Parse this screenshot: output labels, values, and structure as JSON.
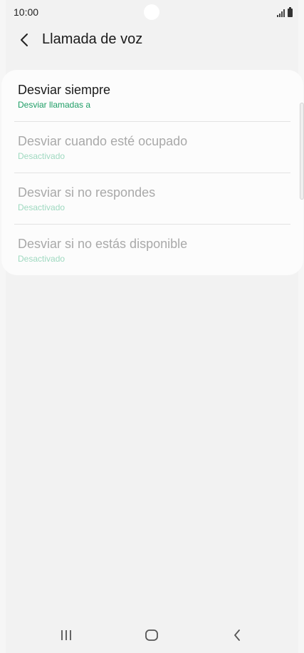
{
  "status_bar": {
    "time": "10:00",
    "signal_icon": "signal-icon",
    "battery_icon": "battery-icon"
  },
  "header": {
    "back_icon": "chevron-left-icon",
    "title": "Llamada de voz"
  },
  "forwarding_options": [
    {
      "title": "Desviar siempre",
      "subtitle": "Desviar llamadas a",
      "enabled": true
    },
    {
      "title": "Desviar cuando esté ocupado",
      "subtitle": "Desactivado",
      "enabled": false
    },
    {
      "title": "Desviar si no respondes",
      "subtitle": "Desactivado",
      "enabled": false
    },
    {
      "title": "Desviar si no estás disponible",
      "subtitle": "Desactivado",
      "enabled": false
    }
  ],
  "nav_bar": {
    "recents_icon": "recent-apps-icon",
    "home_icon": "home-icon",
    "back_icon": "back-icon"
  },
  "colors": {
    "background": "#f2f2f2",
    "card": "#fcfcfc",
    "accent_green": "#1e9e66",
    "disabled_text": "#a9a9a9",
    "disabled_subtext": "#9fd9c0"
  }
}
